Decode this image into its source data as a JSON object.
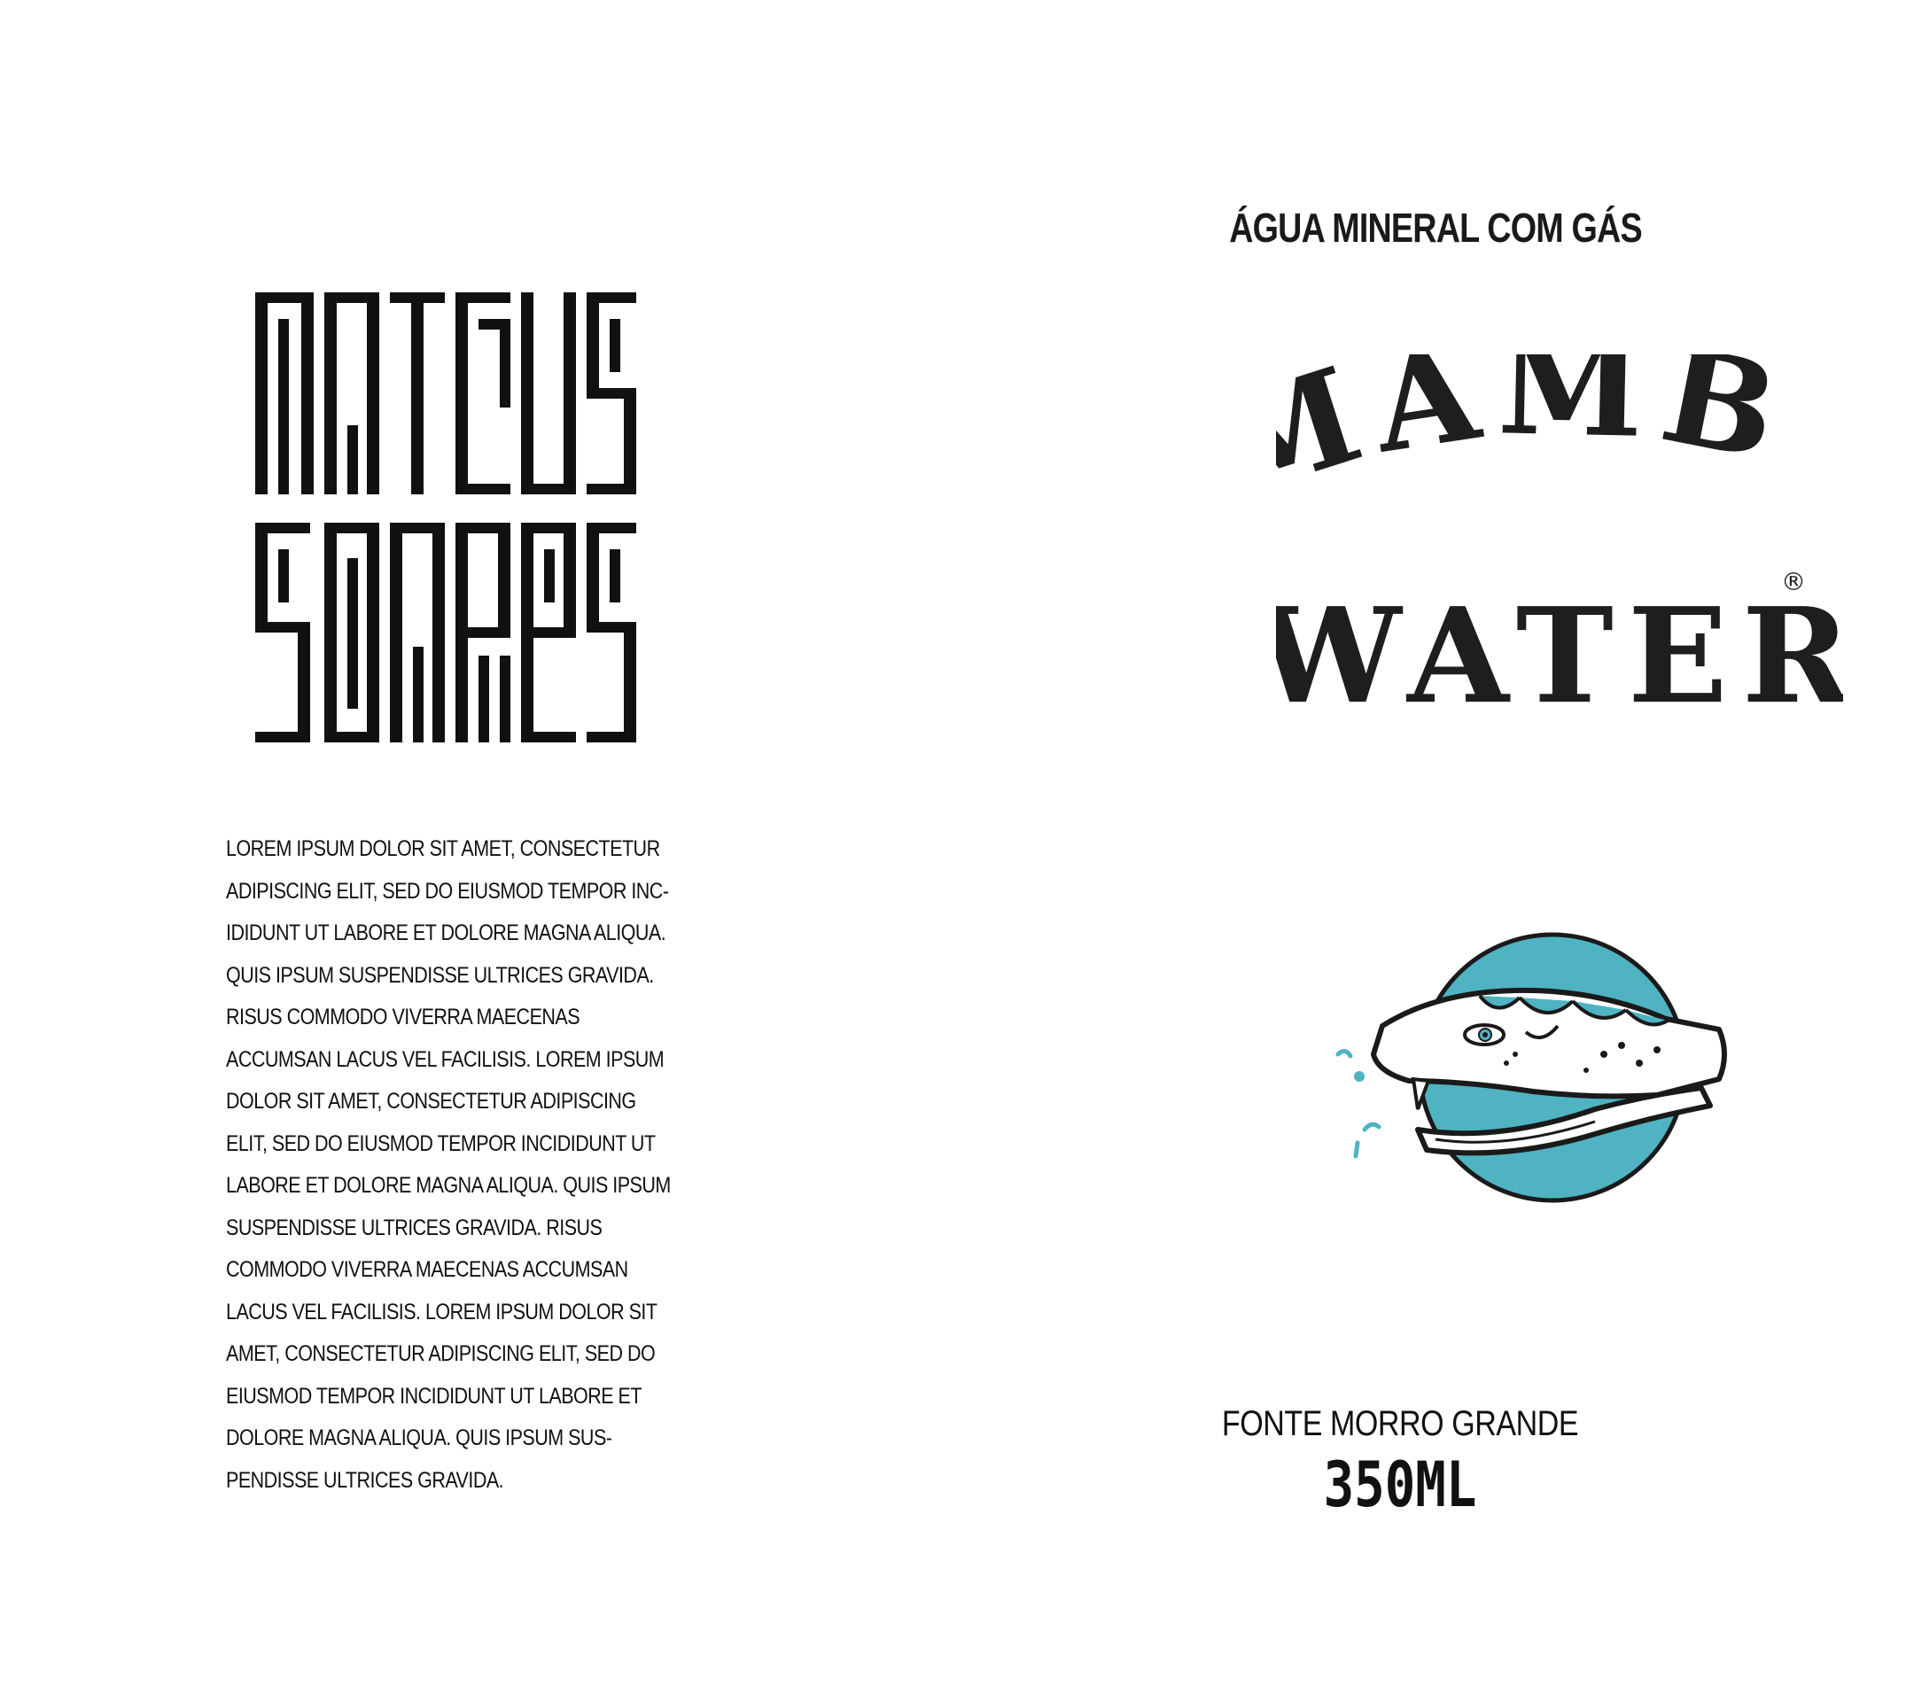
{
  "designer": {
    "logo_text": "Mateus Soares"
  },
  "label": {
    "body_lines": [
      "Lorem ipsum dolor sit amet, consectetur",
      "adipiscing elit, sed do eiusmod tempor inc-",
      "ididunt ut labore et dolore magna aliqua.",
      "Quis ipsum suspendisse ultrices gravida.",
      "Risus commodo viverra maecenas",
      "accumsan lacus vel facilisis. Lorem ipsum",
      "dolor sit amet, consectetur adipiscing",
      "elit, sed do eiusmod tempor incididunt ut",
      "labore et dolore magna aliqua. Quis ipsum",
      "suspendisse ultrices gravida. Risus",
      "commodo viverra maecenas accumsan",
      "lacus vel facilisis. Lorem ipsum dolor sit",
      "amet, consectetur adipiscing elit, sed do",
      "eiusmod tempor incididunt ut labore et",
      "dolore magna aliqua. Quis ipsum sus-",
      "pendisse ultrices gravida."
    ],
    "subtitle": "ÁGUA MINERAL COM GÁS",
    "brand_line1": "MAMBA",
    "brand_line2": "WATER",
    "registered_mark": "®",
    "source": "FONTE MORRO GRANDE",
    "volume": "350ML"
  },
  "colors": {
    "ink": "#1e1e1e",
    "accent_teal": "#4fb3c2",
    "background": "#ffffff"
  },
  "icons": {
    "emblem": "snake-head-emblem-icon"
  }
}
